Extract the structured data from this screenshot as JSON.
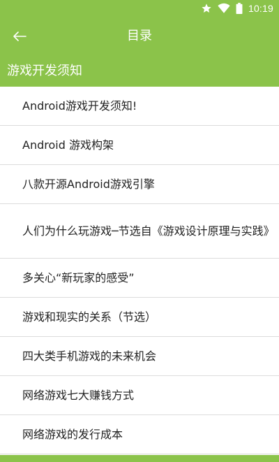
{
  "status_bar": {
    "time": "10:19",
    "icons": [
      "star-icon",
      "wifi-icon",
      "battery-icon"
    ]
  },
  "app_bar": {
    "title": "目录",
    "back_icon": "back-arrow-icon"
  },
  "section": {
    "title": "游戏开发须知"
  },
  "list": {
    "items": [
      "Android游戏开发须知!",
      "Android 游戏构架",
      "八款开源Android游戏引擎",
      "人们为什么玩游戏─节选自《游戏设计原理与实践》",
      "多关心“新玩家的感受”",
      "游戏和现实的关系（节选）",
      "四大类手机游戏的未来机会",
      "网络游戏七大赚钱方式",
      "网络游戏的发行成本"
    ]
  },
  "colors": {
    "primary": "#8bc34a",
    "text": "#222222",
    "divider": "#dcdcdc"
  }
}
